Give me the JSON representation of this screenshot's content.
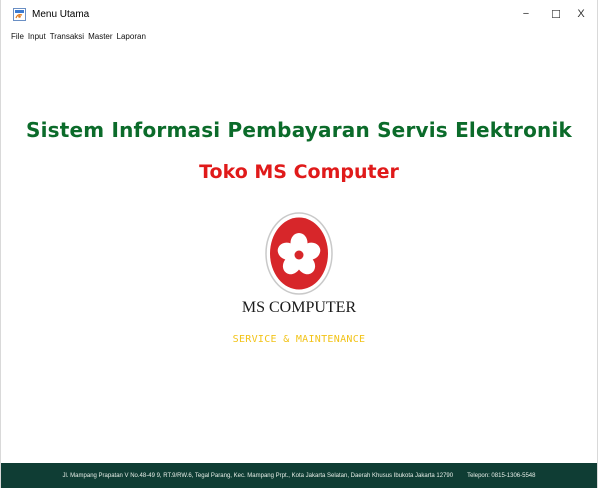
{
  "window": {
    "title": "Menu Utama",
    "icon": "java-app-icon",
    "controls": {
      "minimize": "−",
      "maximize": "☐",
      "close": "X"
    }
  },
  "menu": {
    "items": [
      {
        "label": "File"
      },
      {
        "label": "Input"
      },
      {
        "label": "Transaksi"
      },
      {
        "label": "Master"
      },
      {
        "label": "Laporan"
      }
    ]
  },
  "main": {
    "title": "Sistem Informasi Pembayaran Servis Elektronik",
    "subtitle": "Toko MS Computer",
    "logo": {
      "name": "MS COMPUTER",
      "tagline": "SERVICE & MAINTENANCE"
    }
  },
  "footer": {
    "address": "Jl. Mampang Prapatan V No.48-49 9, RT.9/RW.6, Tegal Parang, Kec. Mampang Prpt., Kota Jakarta Selatan, Daerah Khusus Ibukota Jakarta 12790",
    "phone": "Telepon: 0815-1306-5548"
  },
  "colors": {
    "title_green": "#0b6b2a",
    "subtitle_red": "#e01a1a",
    "logo_red": "#d7262a",
    "tagline_yellow": "#f2c318",
    "footer_bg": "#0f3d34"
  }
}
